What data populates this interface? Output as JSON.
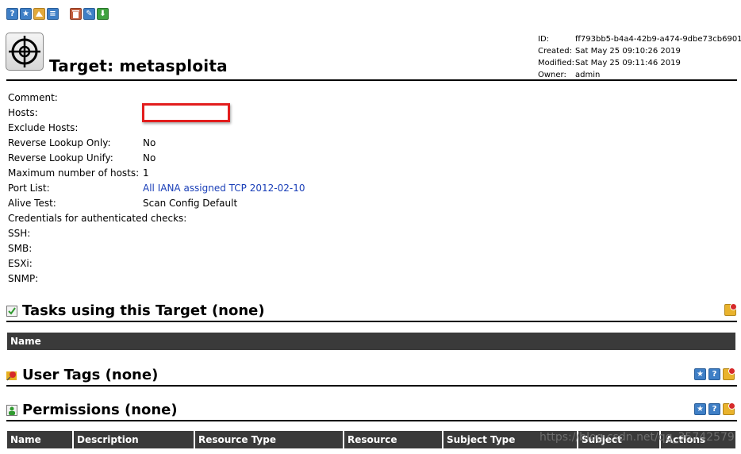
{
  "page": {
    "title": "Target: metasploita"
  },
  "toolbar": {
    "icons": [
      "help-icon",
      "star-icon",
      "wizard-icon",
      "list-icon",
      "trash-icon",
      "edit-icon",
      "download-icon"
    ],
    "glyphs": {
      "help": "?",
      "star": "★",
      "list": "≡",
      "trash": "⌂",
      "edit": "✎",
      "download": "⬇"
    }
  },
  "meta": {
    "id_label": "ID:",
    "id_value": "ff793bb5-b4a4-42b9-a474-9dbe73cb6901",
    "created_label": "Created:",
    "created_value": "Sat May 25 09:10:26 2019",
    "modified_label": "Modified:",
    "modified_value": "Sat May 25 09:11:46 2019",
    "owner_label": "Owner:",
    "owner_value": "admin"
  },
  "details": {
    "comment_label": "Comment:",
    "hosts_label": "Hosts:",
    "exclude_hosts_label": "Exclude Hosts:",
    "reverse_lookup_only_label": "Reverse Lookup Only:",
    "reverse_lookup_only_value": "No",
    "reverse_lookup_unify_label": "Reverse Lookup Unify:",
    "reverse_lookup_unify_value": "No",
    "max_hosts_label": "Maximum number of hosts:",
    "max_hosts_value": "1",
    "port_list_label": "Port List:",
    "port_list_value": "All IANA assigned TCP 2012-02-10",
    "alive_test_label": "Alive Test:",
    "alive_test_value": "Scan Config Default",
    "credentials_label": "Credentials for authenticated checks:",
    "ssh_label": "SSH:",
    "smb_label": "SMB:",
    "esxi_label": "ESXi:",
    "snmp_label": "SNMP:"
  },
  "sections": {
    "tasks": {
      "title": "Tasks using this Target (none)",
      "columns": [
        "Name"
      ]
    },
    "tags": {
      "title": "User Tags (none)"
    },
    "permissions": {
      "title": "Permissions (none)",
      "columns": [
        "Name",
        "Description",
        "Resource Type",
        "Resource",
        "Subject Type",
        "Subject",
        "Actions"
      ]
    },
    "right_icon_glyphs": {
      "star": "★",
      "help": "?"
    }
  },
  "watermark": "https://blog.csdn.net/qq_35742579",
  "colors": {
    "link": "#1a3fb8",
    "header_bar": "#3a3a3a",
    "highlight_border": "#e21d1d"
  }
}
